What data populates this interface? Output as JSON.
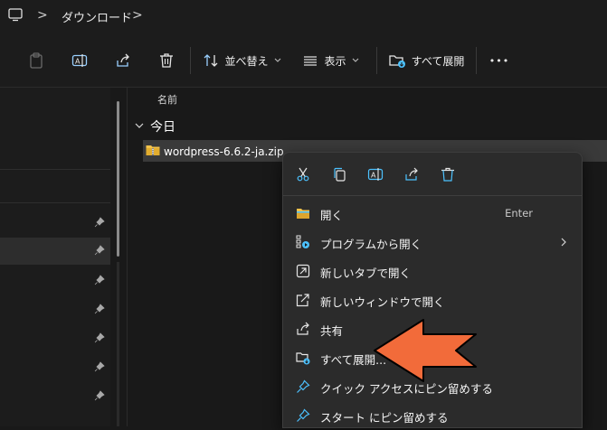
{
  "breadcrumb": {
    "sep1": ">",
    "folder": "ダウンロード",
    "sep2": ">"
  },
  "toolbar": {
    "sort_label": "並べ替え",
    "view_label": "表示",
    "extract_all_label": "すべて展開",
    "more_label": "•••"
  },
  "content": {
    "column_name": "名前",
    "group_today": "今日",
    "file_name": "wordpress-6.6.2-ja.zip"
  },
  "context_menu": {
    "items": [
      {
        "label": "開く",
        "shortcut": "Enter"
      },
      {
        "label": "プログラムから開く"
      },
      {
        "label": "新しいタブで開く"
      },
      {
        "label": "新しいウィンドウで開く"
      },
      {
        "label": "共有"
      },
      {
        "label": "すべて展開..."
      },
      {
        "label": "クイック アクセスにピン留めする"
      },
      {
        "label": "スタート にピン留めする"
      }
    ]
  },
  "colors": {
    "accent_blue": "#4cc2ff",
    "folder_yellow": "#f3c24a",
    "arrow_orange": "#f26b3a"
  }
}
